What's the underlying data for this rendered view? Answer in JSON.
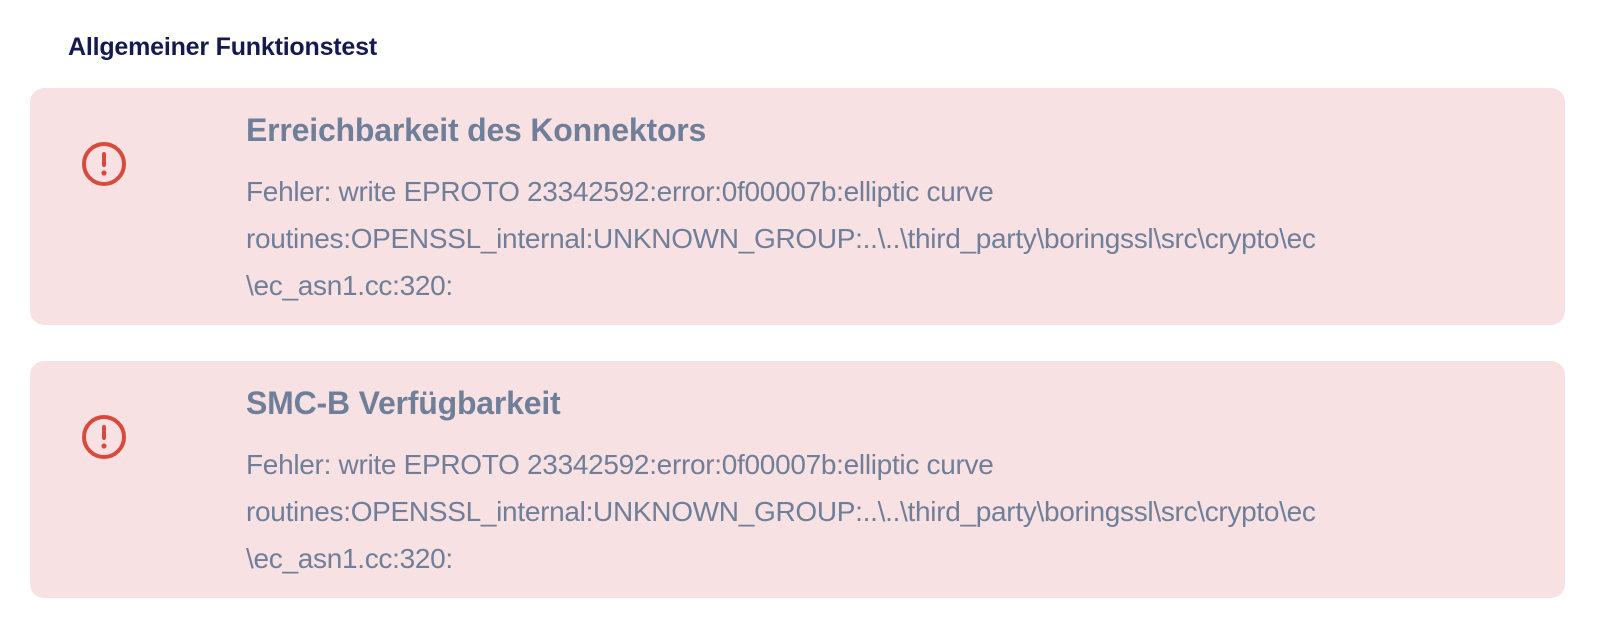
{
  "section": {
    "title": "Allgemeiner Funktionstest"
  },
  "status_colors": {
    "error_background": "#f8e1e2",
    "error_icon": "#d84a3c",
    "text": "#6f7f99",
    "heading": "#141a4e"
  },
  "checks": [
    {
      "icon": "error-exclamation-icon",
      "title": "Erreichbarkeit des Konnektors",
      "message_lines": [
        "Fehler: write EPROTO 23342592:error:0f00007b:elliptic curve",
        "routines:OPENSSL_internal:UNKNOWN_GROUP:..\\..\\third_party\\boringssl\\src\\crypto\\ec",
        "\\ec_asn1.cc:320:"
      ]
    },
    {
      "icon": "error-exclamation-icon",
      "title": "SMC-B Verfügbarkeit",
      "message_lines": [
        "Fehler: write EPROTO 23342592:error:0f00007b:elliptic curve",
        "routines:OPENSSL_internal:UNKNOWN_GROUP:..\\..\\third_party\\boringssl\\src\\crypto\\ec",
        "\\ec_asn1.cc:320:"
      ]
    }
  ]
}
